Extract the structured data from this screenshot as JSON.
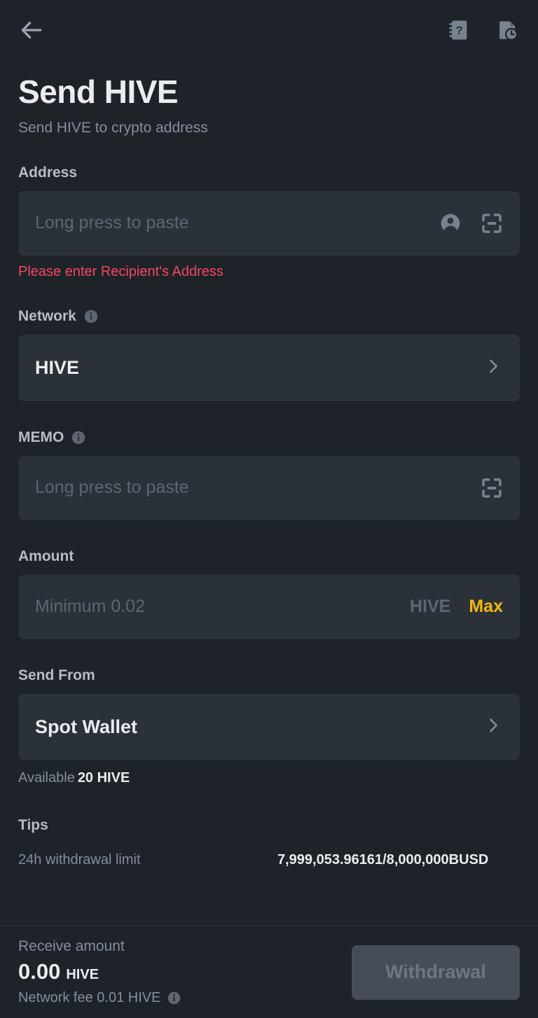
{
  "header": {
    "back_icon": "arrow-left-icon",
    "faq_icon": "faq-book-icon",
    "history_icon": "transaction-history-icon"
  },
  "page": {
    "title": "Send HIVE",
    "subtitle": "Send HIVE to crypto address"
  },
  "address": {
    "label": "Address",
    "placeholder": "Long press to paste",
    "value": "",
    "contact_icon": "contact-person-icon",
    "scan_icon": "qr-scan-icon",
    "error": "Please enter Recipient's Address",
    "error_color": "#F6465D"
  },
  "network": {
    "label": "Network",
    "info_icon": "info-icon",
    "value": "HIVE",
    "chevron_icon": "chevron-right-icon"
  },
  "memo": {
    "label": "MEMO",
    "info_icon": "info-icon",
    "placeholder": "Long press to paste",
    "value": "",
    "scan_icon": "qr-scan-icon"
  },
  "amount": {
    "label": "Amount",
    "placeholder": "Minimum 0.02",
    "value": "",
    "unit": "HIVE",
    "max_label": "Max",
    "max_color": "#F0B90B"
  },
  "send_from": {
    "label": "Send From",
    "value": "Spot Wallet",
    "chevron_icon": "chevron-right-icon",
    "available_label": "Available",
    "available_value": "20 HIVE"
  },
  "tips": {
    "title": "Tips",
    "rows": [
      {
        "key": "24h withdrawal limit",
        "value": "7,999,053.96161/8,000,000BUSD"
      }
    ]
  },
  "bottom": {
    "receive_label": "Receive amount",
    "receive_value": "0.00",
    "receive_unit": "HIVE",
    "fee_text": "Network fee 0.01 HIVE",
    "fee_info_icon": "info-icon",
    "submit_label": "Withdrawal"
  }
}
